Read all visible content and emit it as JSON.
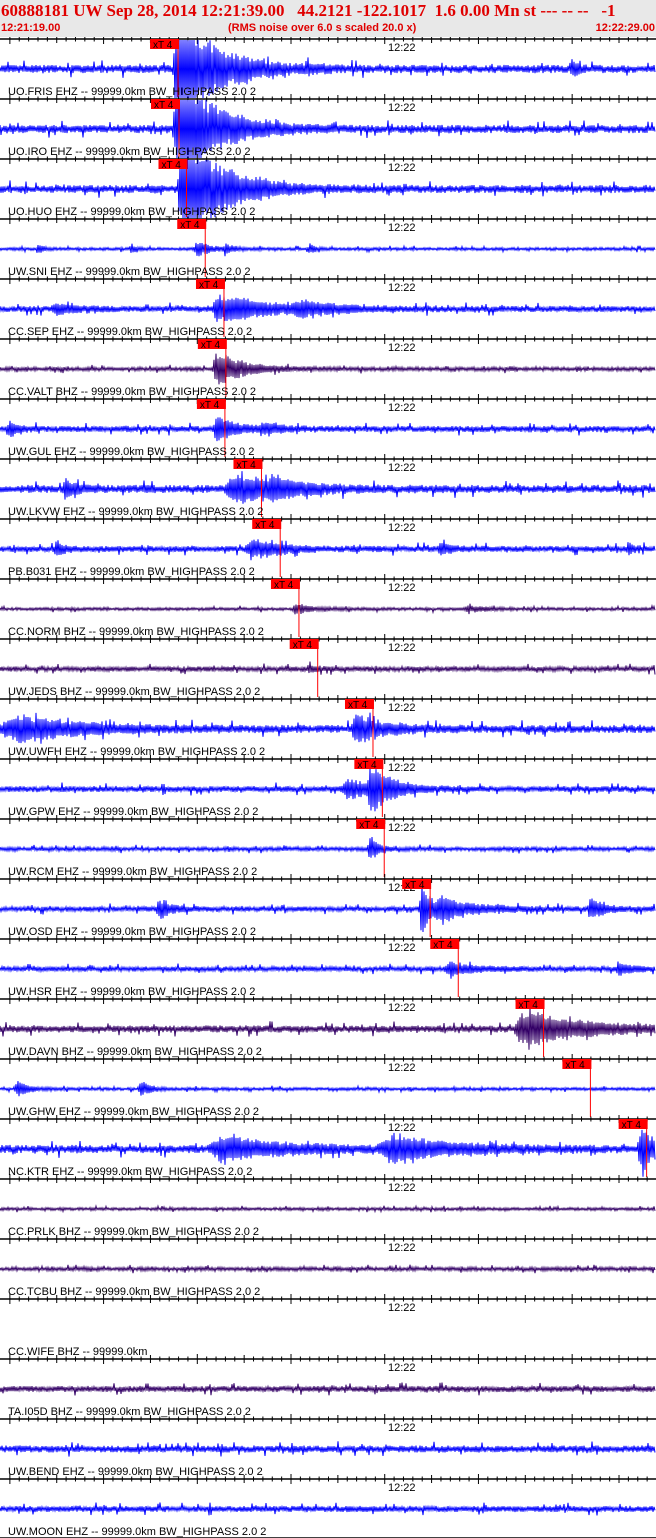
{
  "header": {
    "title": "60888181 UW Sep 28, 2014 12:21:39.00   44.2121 -122.1017  1.6 0.00 Mn st --- -- --   -1",
    "start_time": "12:21:19.00",
    "note": "(RMS noise over 6.0 s scaled 20.0 x)",
    "end_time": "12:22:29.00"
  },
  "chart_data": {
    "type": "line",
    "x_range": [
      "12:21:19.00",
      "12:22:29.00"
    ],
    "x_range_seconds": [
      0,
      70
    ],
    "tick_label": "12:22",
    "pick_label": "xT 4",
    "colors": {
      "ehz": "#0000ff",
      "bhz": "#330066",
      "pick": "#ff0000",
      "title": "#e00000"
    },
    "stations": [
      {
        "label": "UO.FRIS EHZ -- 99999.0km BW_HIGHPASS  2.0  2",
        "pick": "12:21:38.0",
        "comp": "ehz"
      },
      {
        "label": "UO.IRO EHZ -- 99999.0km BW_HIGHPASS  2.0  2",
        "pick": "12:21:38.1",
        "comp": "ehz"
      },
      {
        "label": "UO.HUO EHZ -- 99999.0km BW_HIGHPASS  2.0  2",
        "pick": "12:21:38.9",
        "comp": "ehz"
      },
      {
        "label": "UW.SNI EHZ -- 99999.0km BW_HIGHPASS  2.0  2",
        "pick": "12:21:40.9",
        "comp": "ehz"
      },
      {
        "label": "CC.SEP EHZ -- 99999.0km BW_HIGHPASS  2.0  2",
        "pick": "12:21:42.9",
        "comp": "ehz"
      },
      {
        "label": "CC.VALT BHZ -- 99999.0km BW_HIGHPASS  2.0  2",
        "pick": "12:21:43.1",
        "comp": "bhz"
      },
      {
        "label": "UW.GUL EHZ -- 99999.0km BW_HIGHPASS  2.0  2",
        "pick": "12:21:43.0",
        "comp": "ehz"
      },
      {
        "label": "UW.LKVW EHZ -- 99999.0km BW_HIGHPASS  2.0  2",
        "pick": "12:21:46.9",
        "comp": "ehz"
      },
      {
        "label": "PB.B031 EHZ -- 99999.0km BW_HIGHPASS  2.0  2",
        "pick": "12:21:48.9",
        "comp": "ehz"
      },
      {
        "label": "CC.NORM BHZ -- 99999.0km BW_HIGHPASS  2.0  2",
        "pick": "12:21:50.9",
        "comp": "bhz"
      },
      {
        "label": "UW.JEDS BHZ -- 99999.0km BW_HIGHPASS  2.0  2",
        "pick": "12:21:52.9",
        "comp": "bhz"
      },
      {
        "label": "UW.UWFH EHZ -- 99999.0km BW_HIGHPASS  2.0  2",
        "pick": "12:21:58.8",
        "comp": "ehz"
      },
      {
        "label": "UW.GPW EHZ -- 99999.0km BW_HIGHPASS  2.0  2",
        "pick": "12:21:59.8",
        "comp": "ehz"
      },
      {
        "label": "UW.RCM EHZ -- 99999.0km BW_HIGHPASS  2.0  2",
        "pick": "12:22:00.0",
        "comp": "ehz"
      },
      {
        "label": "UW.OSD EHZ -- 99999.0km BW_HIGHPASS  2.0  2",
        "pick": "12:22:04.9",
        "comp": "ehz"
      },
      {
        "label": "UW.HSR EHZ -- 99999.0km BW_HIGHPASS  2.0  2",
        "pick": "12:22:07.9",
        "comp": "ehz"
      },
      {
        "label": "UW.DAVN BHZ -- 99999.0km BW_HIGHPASS  2.0  2",
        "pick": "12:22:17.0",
        "comp": "bhz"
      },
      {
        "label": "UW.GHW EHZ -- 99999.0km BW_HIGHPASS  2.0  2",
        "pick": "12:22:22.0",
        "comp": "ehz"
      },
      {
        "label": "NC.KTR EHZ -- 99999.0km BW_HIGHPASS  2.0  2",
        "pick": "12:22:28.0",
        "comp": "ehz"
      },
      {
        "label": "CC.PRLK BHZ -- 99999.0km BW_HIGHPASS  2.0  2",
        "pick": null,
        "comp": "bhz"
      },
      {
        "label": "CC.TCBU BHZ -- 99999.0km BW_HIGHPASS  2.0  2",
        "pick": null,
        "comp": "bhz"
      },
      {
        "label": "CC.WIFE BHZ -- 99999.0km",
        "pick": null,
        "comp": "none"
      },
      {
        "label": "TA.I05D BHZ -- 99999.0km BW_HIGHPASS  2.0  2",
        "pick": null,
        "comp": "bhz"
      },
      {
        "label": "UW.BEND EHZ -- 99999.0km BW_HIGHPASS  2.0  2",
        "pick": null,
        "comp": "ehz"
      },
      {
        "label": "UW.MOON EHZ -- 99999.0km BW_HIGHPASS  2.0  2",
        "pick": null,
        "comp": "ehz"
      }
    ]
  }
}
